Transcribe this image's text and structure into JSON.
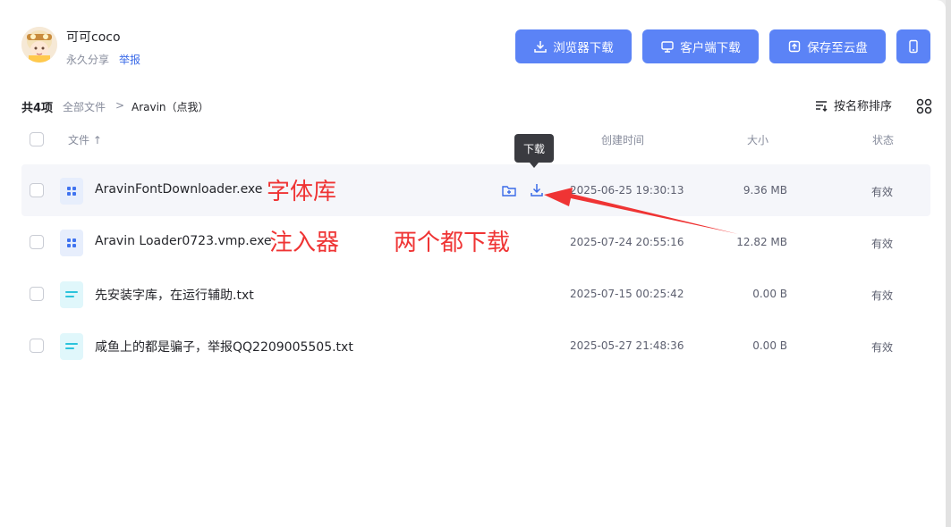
{
  "owner": {
    "name": "可可coco",
    "share_type": "永久分享",
    "report": "举报"
  },
  "header_buttons": {
    "browser_download": "浏览器下载",
    "client_download": "客户端下载",
    "save_to_cloud": "保存至云盘"
  },
  "toolbar": {
    "count": "共4项",
    "breadcrumb": [
      "全部文件",
      ">",
      "Aravin（点我）"
    ],
    "sort_label": "按名称排序"
  },
  "columns": {
    "name": "文件 ↑",
    "created": "创建时间",
    "size": "大小",
    "status": "状态"
  },
  "files": [
    {
      "name": "AravinFontDownloader.exe",
      "created": "2025-06-25 19:30:13",
      "size": "9.36 MB",
      "status": "有效",
      "type": "exe"
    },
    {
      "name": "Aravin Loader0723.vmp.exe",
      "created": "2025-07-24 20:55:16",
      "size": "12.82 MB",
      "status": "有效",
      "type": "exe"
    },
    {
      "name": "先安装字库，在运行辅助.txt",
      "created": "2025-07-15 00:25:42",
      "size": "0.00 B",
      "status": "有效",
      "type": "txt"
    },
    {
      "name": "咸鱼上的都是骗子，举报QQ2209005505.txt",
      "created": "2025-05-27 21:48:36",
      "size": "0.00 B",
      "status": "有效",
      "type": "txt"
    }
  ],
  "tooltip": "下载",
  "annotations": {
    "font_lib": "字体库",
    "injector": "注入器",
    "both_download": "两个都下载"
  },
  "colors": {
    "accent": "#5b83f6",
    "link": "#3a6ae8",
    "annotation": "#ef3434",
    "exe_icon_bg": "#e7eefc",
    "txt_icon_bg": "#e0f7fb"
  }
}
